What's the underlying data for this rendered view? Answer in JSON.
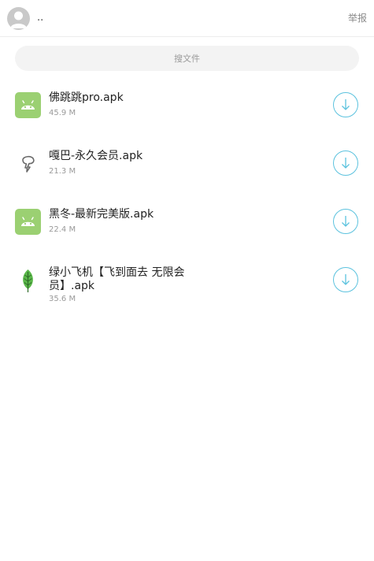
{
  "header": {
    "username": "..",
    "report_label": "举报",
    "avatar_icon": "user-avatar-icon"
  },
  "search": {
    "placeholder": "搜文件",
    "value": ""
  },
  "files": [
    {
      "name": "佛跳跳pro.apk",
      "size": "45.9 M",
      "icon": "android-icon"
    },
    {
      "name": "嘎巴-永久会员.apk",
      "size": "21.3 M",
      "icon": "custom-app-icon"
    },
    {
      "name": "黑冬-最新完美版.apk",
      "size": "22.4 M",
      "icon": "android-icon"
    },
    {
      "name": "绿小飞机【飞到面去 无限会员】.apk",
      "size": "35.6 M",
      "icon": "leaf-icon"
    }
  ],
  "colors": {
    "android_icon_bg": "#9bd072",
    "download_accent": "#5bc2de",
    "leaf": "#5bb84a"
  }
}
